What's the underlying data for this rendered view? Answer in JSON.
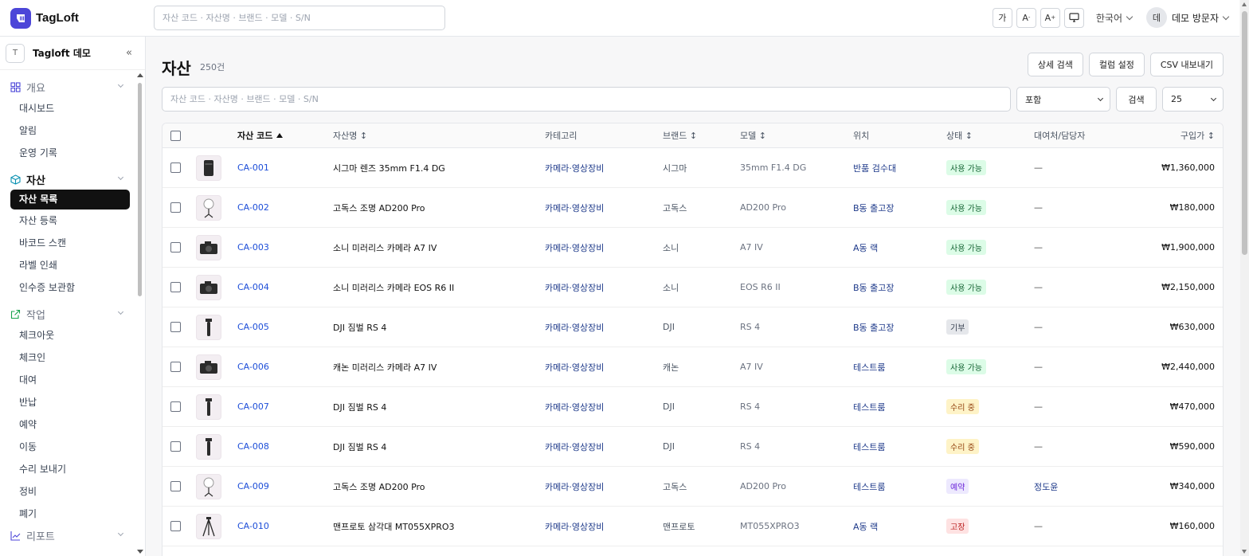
{
  "app": {
    "name": "TagLoft",
    "search_placeholder": "자산 코드 · 자산명 · 브랜드 · 모델 · S/N"
  },
  "topbar": {
    "font_btn": "가",
    "font_smaller": "A",
    "font_smaller_sup": "-",
    "font_larger": "A",
    "font_larger_sup": "+",
    "language": "한국어",
    "user_initial": "데",
    "user_name": "데모 방문자"
  },
  "sidebar": {
    "org_initial": "T",
    "org_name": "Tagloft 데모",
    "collapse": "«",
    "groups": [
      {
        "label": "개요",
        "icon": "grid-icon",
        "items": [
          "대시보드",
          "알림",
          "운영 기록"
        ]
      },
      {
        "label": "자산",
        "icon": "cube-icon",
        "items": [
          "자산 목록",
          "자산 등록",
          "바코드 스캔",
          "라벨 인쇄",
          "인수증 보관함"
        ]
      },
      {
        "label": "작업",
        "icon": "external-edit-icon",
        "items": [
          "체크아웃",
          "체크인",
          "대여",
          "반납",
          "예약",
          "이동",
          "수리 보내기",
          "정비",
          "폐기"
        ]
      },
      {
        "label": "리포트",
        "icon": "chart-icon",
        "items": []
      }
    ]
  },
  "main": {
    "title": "자산",
    "count": "250건",
    "actions": [
      "상세 검색",
      "컬럼 설정",
      "CSV 내보내기"
    ],
    "filter": {
      "placeholder": "자산 코드 · 자산명 · 브랜드 · 모델 · S/N",
      "match_mode": "포함",
      "search_btn": "검색",
      "page_size": "25"
    },
    "columns": {
      "code": "자산 코드",
      "name": "자산명 ↕",
      "category": "카테고리",
      "brand": "브랜드 ↕",
      "model": "모델 ↕",
      "location": "위치",
      "status": "상태 ↕",
      "assignee": "대여처/담당자",
      "price": "구입가 ↕"
    },
    "rows": [
      {
        "thumb": "lens",
        "code": "CA-001",
        "name": "시그마 렌즈 35mm F1.4 DG",
        "category": "카메라·영상장비",
        "brand": "시그마",
        "model": "35mm F1.4 DG",
        "location": "반품 검수대",
        "status": "사용 가능",
        "assignee": "—",
        "price": "₩1,360,000"
      },
      {
        "thumb": "light",
        "code": "CA-002",
        "name": "고독스 조명 AD200 Pro",
        "category": "카메라·영상장비",
        "brand": "고독스",
        "model": "AD200 Pro",
        "location": "B동 출고장",
        "status": "사용 가능",
        "assignee": "—",
        "price": "₩180,000"
      },
      {
        "thumb": "camera",
        "code": "CA-003",
        "name": "소니 미러리스 카메라 A7 IV",
        "category": "카메라·영상장비",
        "brand": "소니",
        "model": "A7 IV",
        "location": "A동 랙",
        "status": "사용 가능",
        "assignee": "—",
        "price": "₩1,900,000"
      },
      {
        "thumb": "camera",
        "code": "CA-004",
        "name": "소니 미러리스 카메라 EOS R6 II",
        "category": "카메라·영상장비",
        "brand": "소니",
        "model": "EOS R6 II",
        "location": "B동 출고장",
        "status": "사용 가능",
        "assignee": "—",
        "price": "₩2,150,000"
      },
      {
        "thumb": "gimbal",
        "code": "CA-005",
        "name": "DJI 짐벌 RS 4",
        "category": "카메라·영상장비",
        "brand": "DJI",
        "model": "RS 4",
        "location": "B동 출고장",
        "status": "기부",
        "assignee": "—",
        "price": "₩630,000"
      },
      {
        "thumb": "camera",
        "code": "CA-006",
        "name": "캐논 미러리스 카메라 A7 IV",
        "category": "카메라·영상장비",
        "brand": "캐논",
        "model": "A7 IV",
        "location": "테스트룸",
        "status": "사용 가능",
        "assignee": "—",
        "price": "₩2,440,000"
      },
      {
        "thumb": "gimbal",
        "code": "CA-007",
        "name": "DJI 짐벌 RS 4",
        "category": "카메라·영상장비",
        "brand": "DJI",
        "model": "RS 4",
        "location": "테스트룸",
        "status": "수리 중",
        "assignee": "—",
        "price": "₩470,000"
      },
      {
        "thumb": "gimbal",
        "code": "CA-008",
        "name": "DJI 짐벌 RS 4",
        "category": "카메라·영상장비",
        "brand": "DJI",
        "model": "RS 4",
        "location": "테스트룸",
        "status": "수리 중",
        "assignee": "—",
        "price": "₩590,000"
      },
      {
        "thumb": "light",
        "code": "CA-009",
        "name": "고독스 조명 AD200 Pro",
        "category": "카메라·영상장비",
        "brand": "고독스",
        "model": "AD200 Pro",
        "location": "테스트룸",
        "status": "예약",
        "assignee": "정도윤",
        "price": "₩340,000"
      },
      {
        "thumb": "tripod",
        "code": "CA-010",
        "name": "맨프로토 삼각대 MT055XPRO3",
        "category": "카메라·영상장비",
        "brand": "맨프로토",
        "model": "MT055XPRO3",
        "location": "A동 랙",
        "status": "고장",
        "assignee": "—",
        "price": "₩160,000"
      }
    ]
  },
  "status_colors": {
    "사용 가능": {
      "bg": "#dcfce7",
      "fg": "#166534"
    },
    "기부": {
      "bg": "#e5e7eb",
      "fg": "#374151"
    },
    "수리 중": {
      "bg": "#fef3c7",
      "fg": "#92400e"
    },
    "예약": {
      "bg": "#ede9fe",
      "fg": "#6d28d9"
    },
    "고장": {
      "bg": "#fee2e2",
      "fg": "#b91c1c"
    }
  },
  "colors": {
    "brand": "#4c46d8",
    "active_nav": "#111111"
  }
}
